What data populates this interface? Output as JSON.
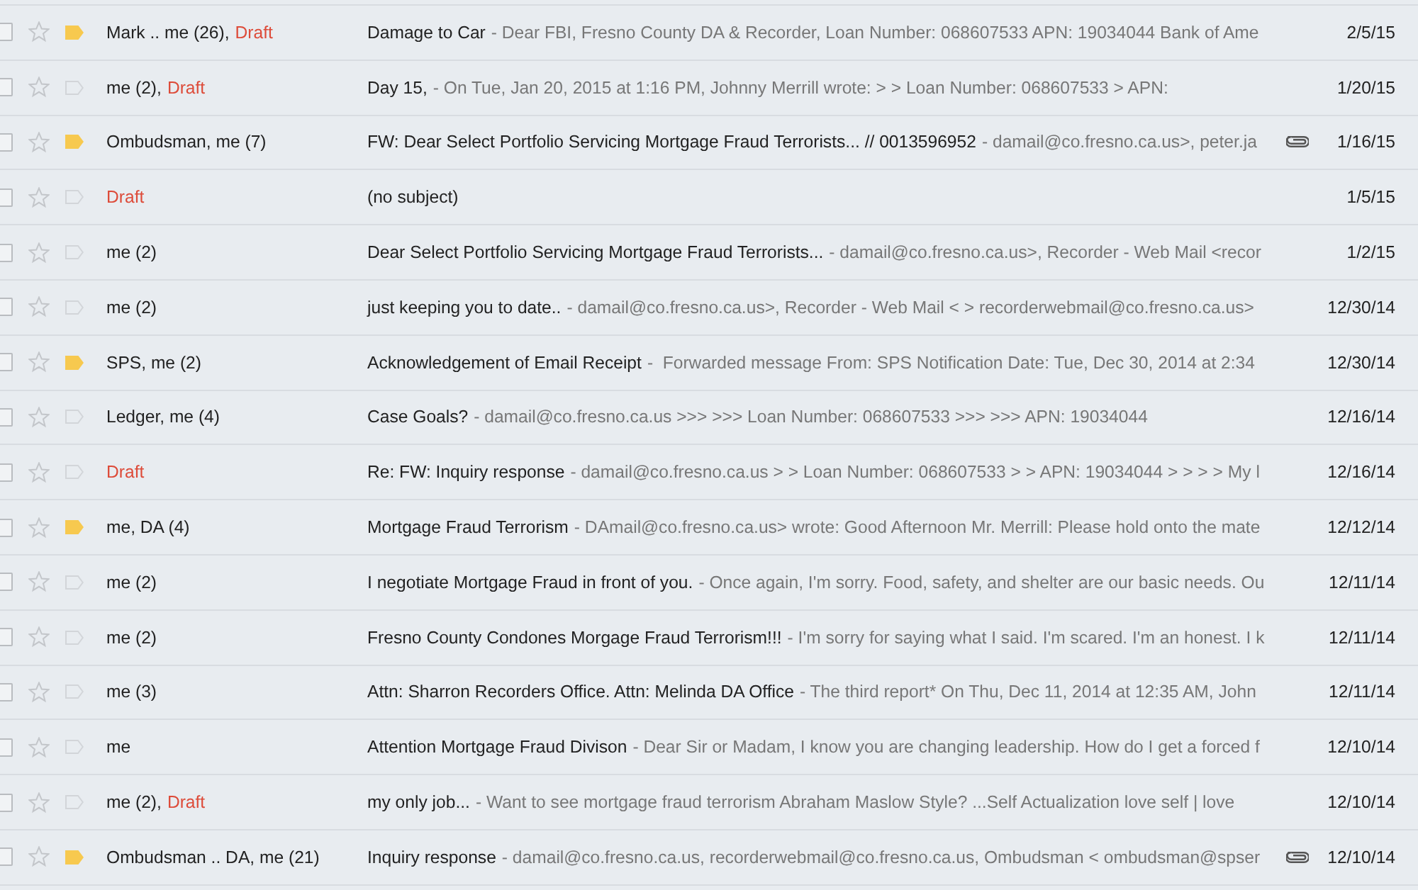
{
  "messages": [
    {
      "checked": false,
      "starred": false,
      "important": true,
      "sender": "Mark .. me (26),",
      "draft": "Draft",
      "subject": "Damage to Car",
      "snippet": "- Dear FBI, Fresno County DA & Recorder, Loan Number: 068607533 APN: 19034044 Bank of Ame",
      "attachment": false,
      "date": "2/5/15"
    },
    {
      "checked": false,
      "starred": false,
      "important": false,
      "sender": "me (2),",
      "draft": "Draft",
      "subject": "Day 15,",
      "snippet": "- On Tue, Jan 20, 2015 at 1:16 PM, Johnny Merrill wrote: > > Loan Number: 068607533 > APN:",
      "attachment": false,
      "date": "1/20/15"
    },
    {
      "checked": false,
      "starred": false,
      "important": true,
      "sender": "Ombudsman, me (7)",
      "subject": "FW: Dear Select Portfolio Servicing Mortgage Fraud Terrorists... // 0013596952",
      "snippet": "- damail@co.fresno.ca.us>, peter.ja",
      "attachment": true,
      "date": "1/16/15"
    },
    {
      "checked": false,
      "starred": false,
      "important": false,
      "draft": "Draft",
      "subject": "(no subject)",
      "attachment": false,
      "date": "1/5/15"
    },
    {
      "checked": false,
      "starred": false,
      "important": false,
      "sender": "me (2)",
      "subject": "Dear Select Portfolio Servicing Mortgage Fraud Terrorists...",
      "snippet": "- damail@co.fresno.ca.us>, Recorder - Web Mail <recor",
      "attachment": false,
      "date": "1/2/15"
    },
    {
      "checked": false,
      "starred": false,
      "important": false,
      "sender": "me (2)",
      "subject": "just keeping you to date..",
      "snippet": "- damail@co.fresno.ca.us>, Recorder - Web Mail < > recorderwebmail@co.fresno.ca.us>",
      "attachment": false,
      "date": "12/30/14"
    },
    {
      "checked": false,
      "starred": false,
      "important": true,
      "sender": "SPS, me (2)",
      "subject": "Acknowledgement of Email Receipt",
      "snippet": "-  Forwarded message From: SPS Notification Date: Tue, Dec 30, 2014 at 2:34",
      "attachment": false,
      "date": "12/30/14"
    },
    {
      "checked": false,
      "starred": false,
      "important": false,
      "sender": "Ledger, me (4)",
      "subject": "Case Goals?",
      "snippet": "- damail@co.fresno.ca.us >>> >>> Loan Number: 068607533 >>> >>> APN: 19034044",
      "attachment": false,
      "date": "12/16/14"
    },
    {
      "checked": false,
      "starred": false,
      "important": false,
      "draft": "Draft",
      "subject": "Re: FW: Inquiry response",
      "snippet": "- damail@co.fresno.ca.us > > Loan Number: 068607533 > > APN: 19034044 > > > > My l",
      "attachment": false,
      "date": "12/16/14"
    },
    {
      "checked": false,
      "starred": false,
      "important": true,
      "sender": "me, DA (4)",
      "subject": "Mortgage Fraud Terrorism",
      "snippet": "- DAmail@co.fresno.ca.us> wrote: Good Afternoon Mr. Merrill: Please hold onto the mate",
      "attachment": false,
      "date": "12/12/14"
    },
    {
      "checked": false,
      "starred": false,
      "important": false,
      "sender": "me (2)",
      "subject": "I negotiate Mortgage Fraud in front of you.",
      "snippet": "- Once again, I'm sorry. Food, safety, and shelter are our basic needs. Ou",
      "attachment": false,
      "date": "12/11/14"
    },
    {
      "checked": false,
      "starred": false,
      "important": false,
      "sender": "me (2)",
      "subject": "Fresno County Condones Morgage Fraud Terrorism!!!",
      "snippet": "- I'm sorry for saying what I said. I'm scared. I'm an honest. I k",
      "attachment": false,
      "date": "12/11/14"
    },
    {
      "checked": false,
      "starred": false,
      "important": false,
      "sender": "me (3)",
      "subject": "Attn: Sharron Recorders Office. Attn: Melinda DA Office",
      "snippet": "- The third report* On Thu, Dec 11, 2014 at 12:35 AM, John",
      "attachment": false,
      "date": "12/11/14"
    },
    {
      "checked": false,
      "starred": false,
      "important": false,
      "sender": "me",
      "subject": "Attention Mortgage Fraud Divison",
      "snippet": "- Dear Sir or Madam, I know you are changing leadership. How do I get a forced f",
      "attachment": false,
      "date": "12/10/14"
    },
    {
      "checked": false,
      "starred": false,
      "important": false,
      "sender": "me (2),",
      "draft": "Draft",
      "subject": "my only job...",
      "snippet": "- Want to see mortgage fraud terrorism Abraham Maslow Style? ...Self Actualization love self | love",
      "attachment": false,
      "date": "12/10/14"
    },
    {
      "checked": false,
      "starred": false,
      "important": true,
      "sender": "Ombudsman .. DA, me (21)",
      "subject": "Inquiry response",
      "snippet": "- damail@co.fresno.ca.us, recorderwebmail@co.fresno.ca.us, Ombudsman < ombudsman@spser",
      "attachment": true,
      "date": "12/10/14"
    }
  ]
}
